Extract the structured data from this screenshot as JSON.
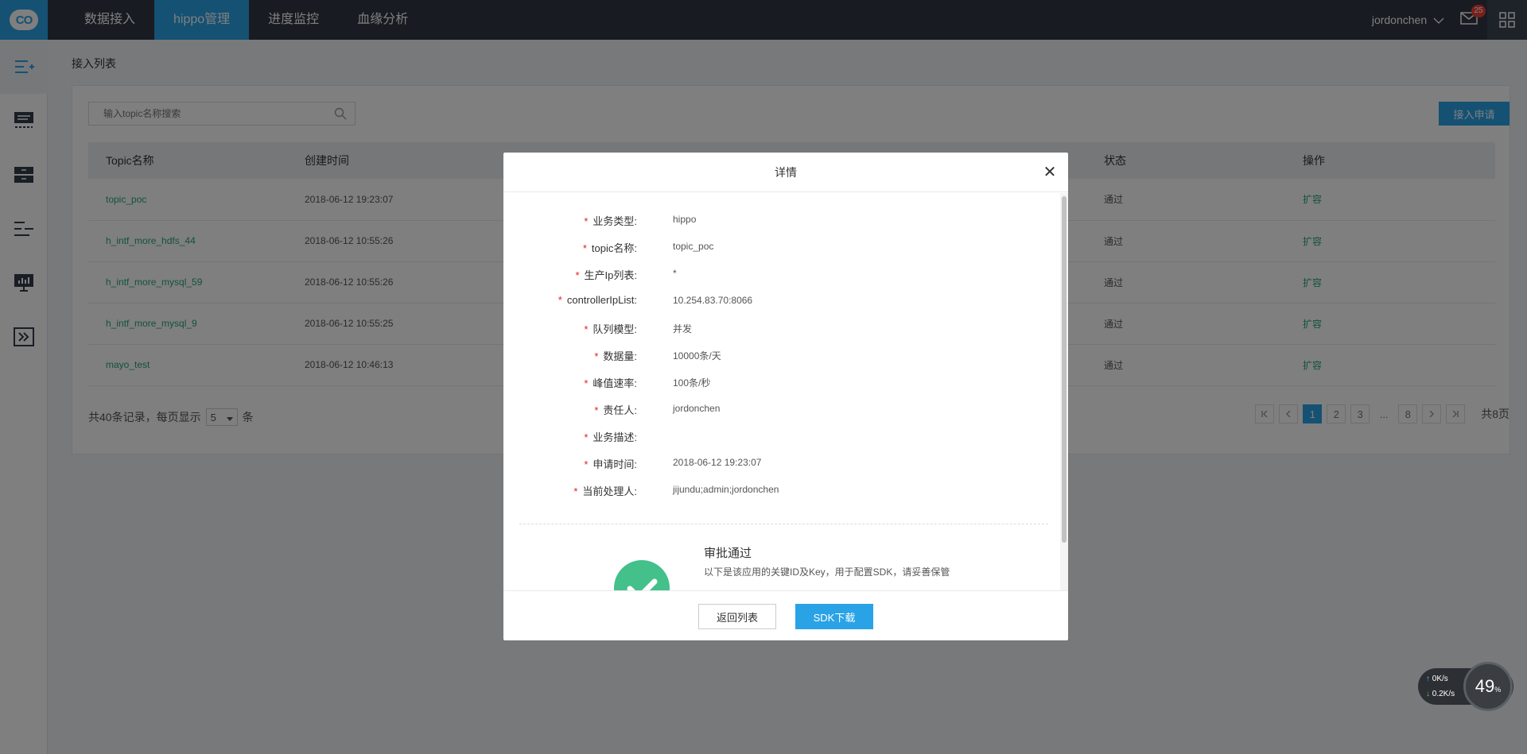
{
  "topbar": {
    "logo": "CO",
    "nav": [
      "数据接入",
      "hippo管理",
      "进度监控",
      "血缘分析"
    ],
    "active_nav": "hippo管理",
    "user": "jordonchen",
    "mail_count": "25"
  },
  "sidebar": {
    "icons": [
      "topic-list-icon",
      "monitor-list-icon",
      "storage-icon",
      "text-list-icon",
      "dashboard-icon",
      "forward-icon"
    ]
  },
  "page": {
    "breadcrumb": "接入列表",
    "search_placeholder": "输入topic名称搜索",
    "apply_button": "接入申请",
    "columns": {
      "topic": "Topic名称",
      "created": "创建时间",
      "status": "状态",
      "action": "操作"
    },
    "rows": [
      {
        "topic": "topic_poc",
        "created": "2018-06-12 19:23:07",
        "status": "通过",
        "action": "扩容"
      },
      {
        "topic": "h_intf_more_hdfs_44",
        "created": "2018-06-12 10:55:26",
        "status": "通过",
        "action": "扩容"
      },
      {
        "topic": "h_intf_more_mysql_59",
        "created": "2018-06-12 10:55:26",
        "status": "通过",
        "action": "扩容"
      },
      {
        "topic": "h_intf_more_mysql_9",
        "created": "2018-06-12 10:55:25",
        "status": "通过",
        "action": "扩容"
      },
      {
        "topic": "mayo_test",
        "created": "2018-06-12 10:46:13",
        "status": "通过",
        "action": "扩容"
      }
    ],
    "pager": {
      "summary_prefix": "共40条记录，每页显示",
      "page_size": "5",
      "summary_suffix": "条",
      "pages": [
        "1",
        "2",
        "3",
        "...",
        "8"
      ],
      "current": "1",
      "total": "共8页"
    }
  },
  "modal": {
    "title": "详情",
    "fields": [
      {
        "label": "业务类型:",
        "value": "hippo"
      },
      {
        "label": "topic名称:",
        "value": "topic_poc"
      },
      {
        "label": "生产Ip列表:",
        "value": "*"
      },
      {
        "label": "controllerIpList:",
        "value": "10.254.83.70:8066"
      },
      {
        "label": "队列模型:",
        "value": "并发"
      },
      {
        "label": "数据量:",
        "value": "10000条/天"
      },
      {
        "label": "峰值速率:",
        "value": "100条/秒"
      },
      {
        "label": "责任人:",
        "value": "jordonchen"
      },
      {
        "label": "业务描述:",
        "value": ""
      },
      {
        "label": "申请时间:",
        "value": "2018-06-12 19:23:07"
      },
      {
        "label": "当前处理人:",
        "value": "jijundu;admin;jordonchen"
      }
    ],
    "approve_title": "审批通过",
    "approve_desc": "以下是该应用的关键ID及Key，用于配置SDK，请妥善保管",
    "back_button": "返回列表",
    "sdk_button": "SDK下载"
  },
  "network": {
    "up": "0K/s",
    "down": "0.2K/s",
    "percent": "49",
    "percent_unit": "%"
  }
}
